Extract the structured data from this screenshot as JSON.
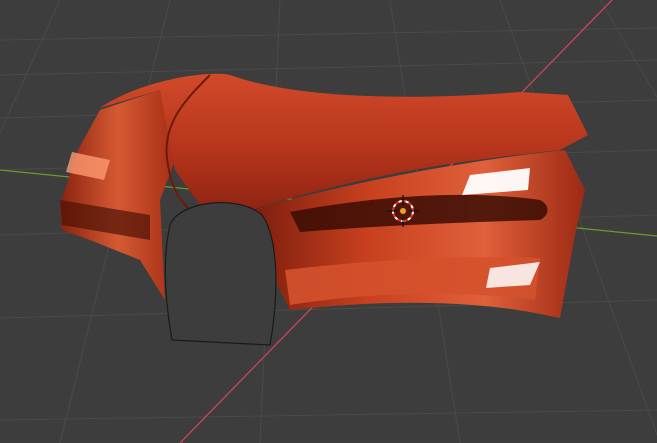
{
  "app": {
    "view": "3d-viewport",
    "colors": {
      "background": "#3d3d3d",
      "grid_line": "#4a4a4a",
      "x_axis": "#c4475a",
      "y_axis": "#6a9a2f",
      "mesh_base": "#c0391f",
      "mesh_dark": "#5e1508",
      "mesh_highlight": "#ff8a60",
      "specular": "#ffffff",
      "origin_fill": "#f0a020"
    },
    "objects": [
      {
        "name": "car-front-mesh",
        "kind": "mesh"
      },
      {
        "name": "3d-cursor",
        "kind": "cursor"
      }
    ]
  }
}
